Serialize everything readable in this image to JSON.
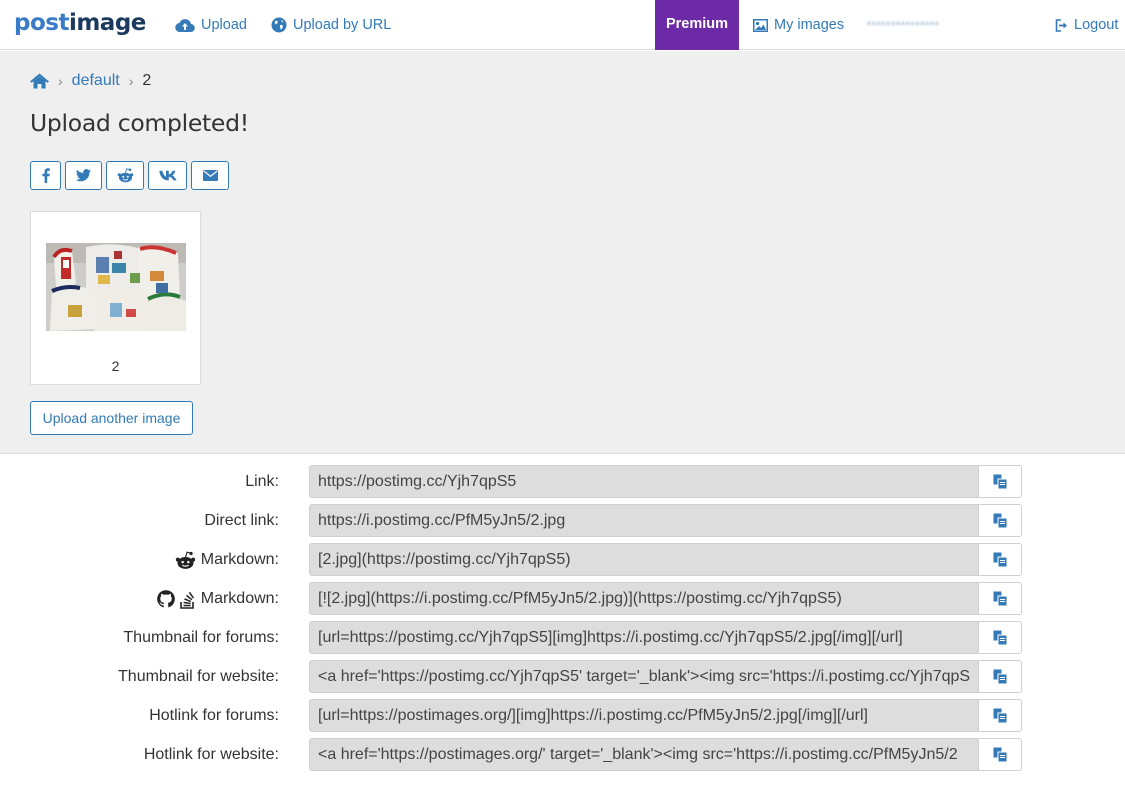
{
  "brand": {
    "part1": "post",
    "part2": "image"
  },
  "nav": {
    "upload": "Upload",
    "upload_url": "Upload by URL",
    "premium": "Premium",
    "my_images": "My images",
    "user": "•••••••••••••••",
    "logout": "Logout"
  },
  "breadcrumb": {
    "gallery": "default",
    "current": "2"
  },
  "title": "Upload completed!",
  "share_buttons": [
    "facebook-icon",
    "twitter-icon",
    "reddit-icon",
    "vk-icon",
    "envelope-icon"
  ],
  "image": {
    "caption": "2"
  },
  "upload_another": "Upload another image",
  "links": [
    {
      "label": "Link:",
      "icons": [],
      "value": "https://postimg.cc/Yjh7qpS5"
    },
    {
      "label": "Direct link:",
      "icons": [],
      "value": "https://i.postimg.cc/PfM5yJn5/2.jpg"
    },
    {
      "label": "Markdown:",
      "icons": [
        "reddit-icon"
      ],
      "value": "[2.jpg](https://postimg.cc/Yjh7qpS5)"
    },
    {
      "label": "Markdown:",
      "icons": [
        "github-icon",
        "stackoverflow-icon"
      ],
      "value": "[![2.jpg](https://i.postimg.cc/PfM5yJn5/2.jpg)](https://postimg.cc/Yjh7qpS5)"
    },
    {
      "label": "Thumbnail for forums:",
      "icons": [],
      "value": "[url=https://postimg.cc/Yjh7qpS5][img]https://i.postimg.cc/Yjh7qpS5/2.jpg[/img][/url]"
    },
    {
      "label": "Thumbnail for website:",
      "icons": [],
      "value": "<a href='https://postimg.cc/Yjh7qpS5' target='_blank'><img src='https://i.postimg.cc/Yjh7qpS"
    },
    {
      "label": "Hotlink for forums:",
      "icons": [],
      "value": "[url=https://postimages.org/][img]https://i.postimg.cc/PfM5yJn5/2.jpg[/img][/url]"
    },
    {
      "label": "Hotlink for website:",
      "icons": [],
      "value": "<a href='https://postimages.org/' target='_blank'><img src='https://i.postimg.cc/PfM5yJn5/2"
    }
  ],
  "colors": {
    "accent": "#337ab7",
    "premium": "#6c2aa6",
    "panel": "#efefef",
    "field": "#dddddd"
  }
}
